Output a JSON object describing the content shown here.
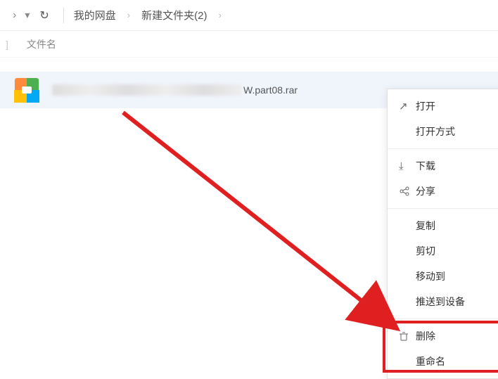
{
  "toolbar": {
    "breadcrumb": [
      {
        "label": "我的网盘"
      },
      {
        "label": "新建文件夹(2)"
      }
    ]
  },
  "columns": {
    "name": "文件名"
  },
  "file": {
    "visible_suffix": "W.part08.rar"
  },
  "context_menu": {
    "items": [
      {
        "icon": "open-icon",
        "glyph": "↗",
        "label": "打开"
      },
      {
        "icon": "",
        "glyph": "",
        "label": "打开方式"
      },
      {
        "sep": true
      },
      {
        "icon": "download-icon",
        "glyph": "⤓",
        "label": "下载"
      },
      {
        "icon": "share-icon",
        "glyph": "⚬⚬",
        "label": "分享"
      },
      {
        "sep": true
      },
      {
        "icon": "",
        "glyph": "",
        "label": "复制"
      },
      {
        "icon": "",
        "glyph": "",
        "label": "剪切"
      },
      {
        "icon": "",
        "glyph": "",
        "label": "移动到"
      },
      {
        "icon": "",
        "glyph": "",
        "label": "推送到设备"
      },
      {
        "sep": true
      },
      {
        "icon": "delete-icon",
        "glyph": "🗑",
        "label": "删除"
      },
      {
        "icon": "",
        "glyph": "",
        "label": "重命名"
      }
    ]
  }
}
